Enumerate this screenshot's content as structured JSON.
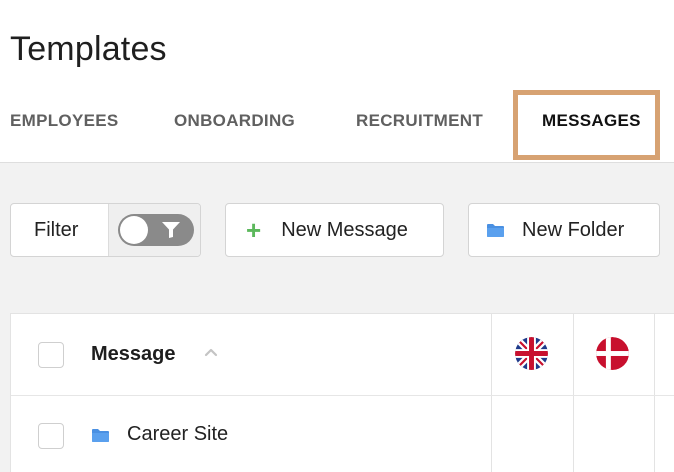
{
  "page": {
    "title": "Templates"
  },
  "tabs": [
    {
      "label": "EMPLOYEES",
      "active": false
    },
    {
      "label": "ONBOARDING",
      "active": false
    },
    {
      "label": "RECRUITMENT",
      "active": false
    },
    {
      "label": "MESSAGES",
      "active": true
    }
  ],
  "toolbar": {
    "filter_label": "Filter",
    "new_message_label": "New Message",
    "new_folder_label": "New Folder"
  },
  "table": {
    "columns": {
      "message": "Message"
    },
    "languages": [
      {
        "icon": "uk-flag-icon"
      },
      {
        "icon": "denmark-flag-icon"
      }
    ],
    "rows": [
      {
        "type": "folder",
        "label": "Career Site"
      }
    ]
  },
  "colors": {
    "accent_highlight": "#d7a272",
    "plus_green": "#5cb85c",
    "folder_blue": "#4a90e2",
    "toggle_gray": "#8a8a8a"
  }
}
